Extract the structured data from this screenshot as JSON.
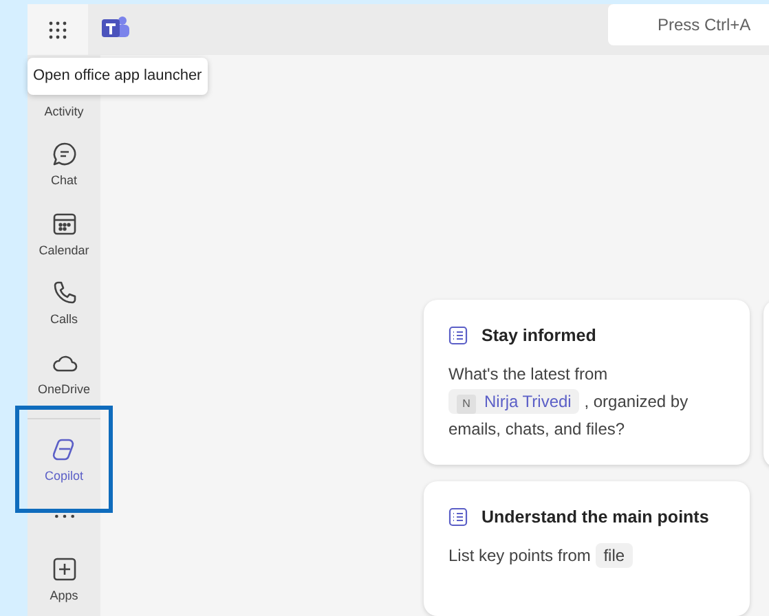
{
  "tooltip": {
    "text": "Open office app launcher"
  },
  "search": {
    "placeholder": "Press Ctrl+A"
  },
  "sidebar": {
    "items": [
      {
        "kind": "activity",
        "label": "Activity",
        "selected": false,
        "focused": false
      },
      {
        "kind": "chat",
        "label": "Chat",
        "selected": false,
        "focused": false
      },
      {
        "kind": "calendar",
        "label": "Calendar",
        "selected": false,
        "focused": false
      },
      {
        "kind": "calls",
        "label": "Calls",
        "selected": false,
        "focused": false
      },
      {
        "kind": "onedrive",
        "label": "OneDrive",
        "selected": false,
        "focused": false
      },
      {
        "kind": "copilot",
        "label": "Copilot",
        "selected": true,
        "focused": true
      },
      {
        "kind": "more",
        "selected": false,
        "focused": false
      },
      {
        "kind": "apps",
        "label": "Apps",
        "selected": false,
        "focused": false
      }
    ]
  },
  "prompt_cards": [
    {
      "title": "Stay informed",
      "parts": [
        {
          "kind": "text",
          "text": "What's the latest from"
        },
        {
          "kind": "person",
          "initial": "N",
          "text": "Nirja Trivedi"
        },
        {
          "kind": "text",
          "text": ", organized by emails, chats, and files?"
        }
      ]
    },
    {
      "title": "Understand the main points",
      "parts": [
        {
          "kind": "text",
          "text": "List key points from"
        },
        {
          "kind": "token",
          "text": "file"
        }
      ]
    }
  ]
}
